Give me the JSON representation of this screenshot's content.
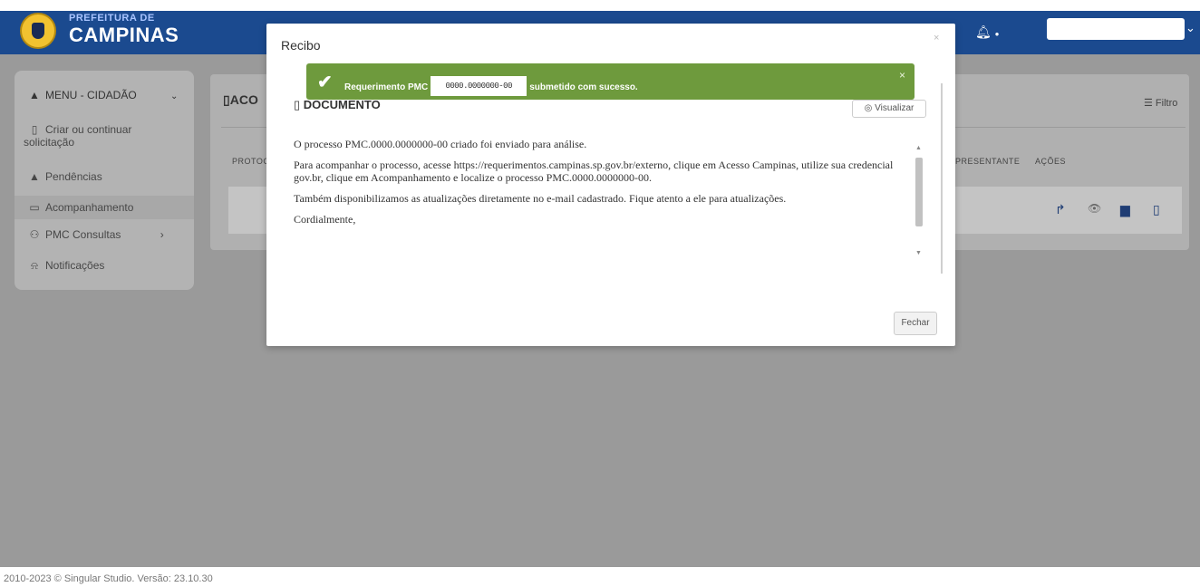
{
  "header": {
    "logo_small": "PREFEITURA DE",
    "logo_big": "CAMPINAS",
    "bell_icon": "bell-icon",
    "user_chevron": "chevron-down-icon"
  },
  "sidebar": {
    "menu_title": "MENU - CIDADÃO",
    "items": [
      {
        "icon": "document-icon",
        "label_1": "Criar ou continuar",
        "label_2": "solicitação"
      },
      {
        "icon": "warning-icon",
        "label": "Pendências"
      },
      {
        "icon": "folder-icon",
        "label": "Acompanhamento"
      },
      {
        "icon": "people-icon",
        "label": "PMC Consultas"
      },
      {
        "icon": "bell-icon",
        "label": "Notificações"
      }
    ]
  },
  "panel": {
    "title": "ACO",
    "filter": "Filtro",
    "col_protocolo": "PROTOC",
    "col_representante": "PRESENTANTE",
    "col_acoes": "AÇÕES"
  },
  "modal": {
    "title": "Recibo",
    "close": "×",
    "document_header": "DOCUMENTO",
    "visualizar": "Visualizar",
    "paragraphs": [
      "O processo PMC.0000.0000000-00   criado foi enviado para análise.",
      "Para acompanhar o processo, acesse https://requerimentos.campinas.sp.gov.br/externo, clique em Acesso Campinas, utilize sua credencial gov.br, clique em Acompanhamento e localize o processo PMC.0000.0000000-00.",
      "Também disponibilizamos as atualizações diretamente no e-mail cadastrado. Fique atento a ele para atualizações.",
      "Cordialmente,"
    ],
    "fechar": "Fechar"
  },
  "toast": {
    "prefix": "Requerimento PMC",
    "masked": "0000.0000000-00",
    "suffix": "submetido com sucesso.",
    "close": "×"
  },
  "footer": {
    "text": "2010-2023 © Singular Studio. Versão: 23.10.30"
  },
  "colors": {
    "header_blue": "#1b4a8f",
    "toast_green": "#6e9a3d",
    "overlay_gray": "#9a9a9a"
  }
}
